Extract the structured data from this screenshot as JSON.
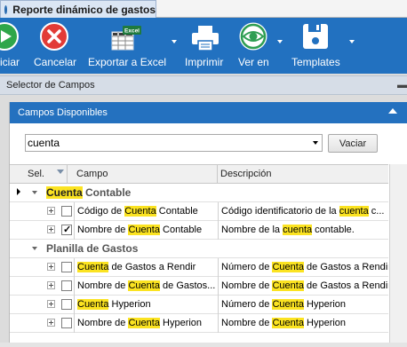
{
  "window": {
    "tab_title": "Reporte dinámico de gastos"
  },
  "toolbar": {
    "buttons": [
      {
        "label": "iciar",
        "icon": "play-icon",
        "has_dropdown": false
      },
      {
        "label": "Cancelar",
        "icon": "cancel-icon",
        "has_dropdown": false
      },
      {
        "label": "Exportar a Excel",
        "icon": "excel-export-icon",
        "has_dropdown": true
      },
      {
        "label": "Imprimir",
        "icon": "printer-icon",
        "has_dropdown": false
      },
      {
        "label": "Ver en",
        "icon": "eye-icon",
        "has_dropdown": true
      },
      {
        "label": "Templates",
        "icon": "floppy-save-icon",
        "has_dropdown": true
      }
    ],
    "excel_badge": "Excel"
  },
  "selector": {
    "title": "Selector de Campos"
  },
  "panel": {
    "title": "Campos Disponibles",
    "search": {
      "value": "cuenta",
      "placeholder": ""
    },
    "clear_label": "Vaciar"
  },
  "grid": {
    "columns": [
      "Sel.",
      "Campo",
      "Descripción"
    ],
    "groups": [
      {
        "label_highlight": "Cuenta",
        "label_rest": " Contable",
        "rows": [
          {
            "checked": false,
            "campo": [
              [
                "Código de ",
                false
              ],
              [
                "Cuenta",
                true
              ],
              [
                " Contable",
                false
              ]
            ],
            "descripcion": [
              [
                "Código identificatorio de la ",
                false
              ],
              [
                "cuenta",
                true
              ],
              [
                " c...",
                false
              ]
            ]
          },
          {
            "checked": true,
            "campo": [
              [
                "Nombre de ",
                false
              ],
              [
                "Cuenta",
                true
              ],
              [
                " Contable",
                false
              ]
            ],
            "descripcion": [
              [
                "Nombre de la ",
                false
              ],
              [
                "cuenta",
                true
              ],
              [
                " contable.",
                false
              ]
            ]
          }
        ]
      },
      {
        "label_highlight": "",
        "label_rest": "Planilla de Gastos",
        "rows": [
          {
            "checked": false,
            "campo": [
              [
                "Cuenta",
                true
              ],
              [
                " de Gastos a Rendir",
                false
              ]
            ],
            "descripcion": [
              [
                "Número de ",
                false
              ],
              [
                "Cuenta",
                true
              ],
              [
                " de Gastos a Rendir",
                false
              ]
            ]
          },
          {
            "checked": false,
            "campo": [
              [
                "Nombre de ",
                false
              ],
              [
                "Cuenta",
                true
              ],
              [
                " de Gastos...",
                false
              ]
            ],
            "descripcion": [
              [
                "Nombre de ",
                false
              ],
              [
                "Cuenta",
                true
              ],
              [
                " de Gastos a Rendir",
                false
              ]
            ]
          },
          {
            "checked": false,
            "campo": [
              [
                "Cuenta",
                true
              ],
              [
                " Hyperion",
                false
              ]
            ],
            "descripcion": [
              [
                "Número de ",
                false
              ],
              [
                "Cuenta",
                true
              ],
              [
                " Hyperion",
                false
              ]
            ]
          },
          {
            "checked": false,
            "campo": [
              [
                "Nombre de ",
                false
              ],
              [
                "Cuenta",
                true
              ],
              [
                " Hyperion",
                false
              ]
            ],
            "descripcion": [
              [
                "Nombre de ",
                false
              ],
              [
                "Cuenta",
                true
              ],
              [
                " Hyperion",
                false
              ]
            ]
          }
        ]
      }
    ]
  },
  "colors": {
    "toolbar_bg": "#2271c0",
    "panel_header_bg": "#2471bf",
    "highlight": "#fbe321"
  }
}
